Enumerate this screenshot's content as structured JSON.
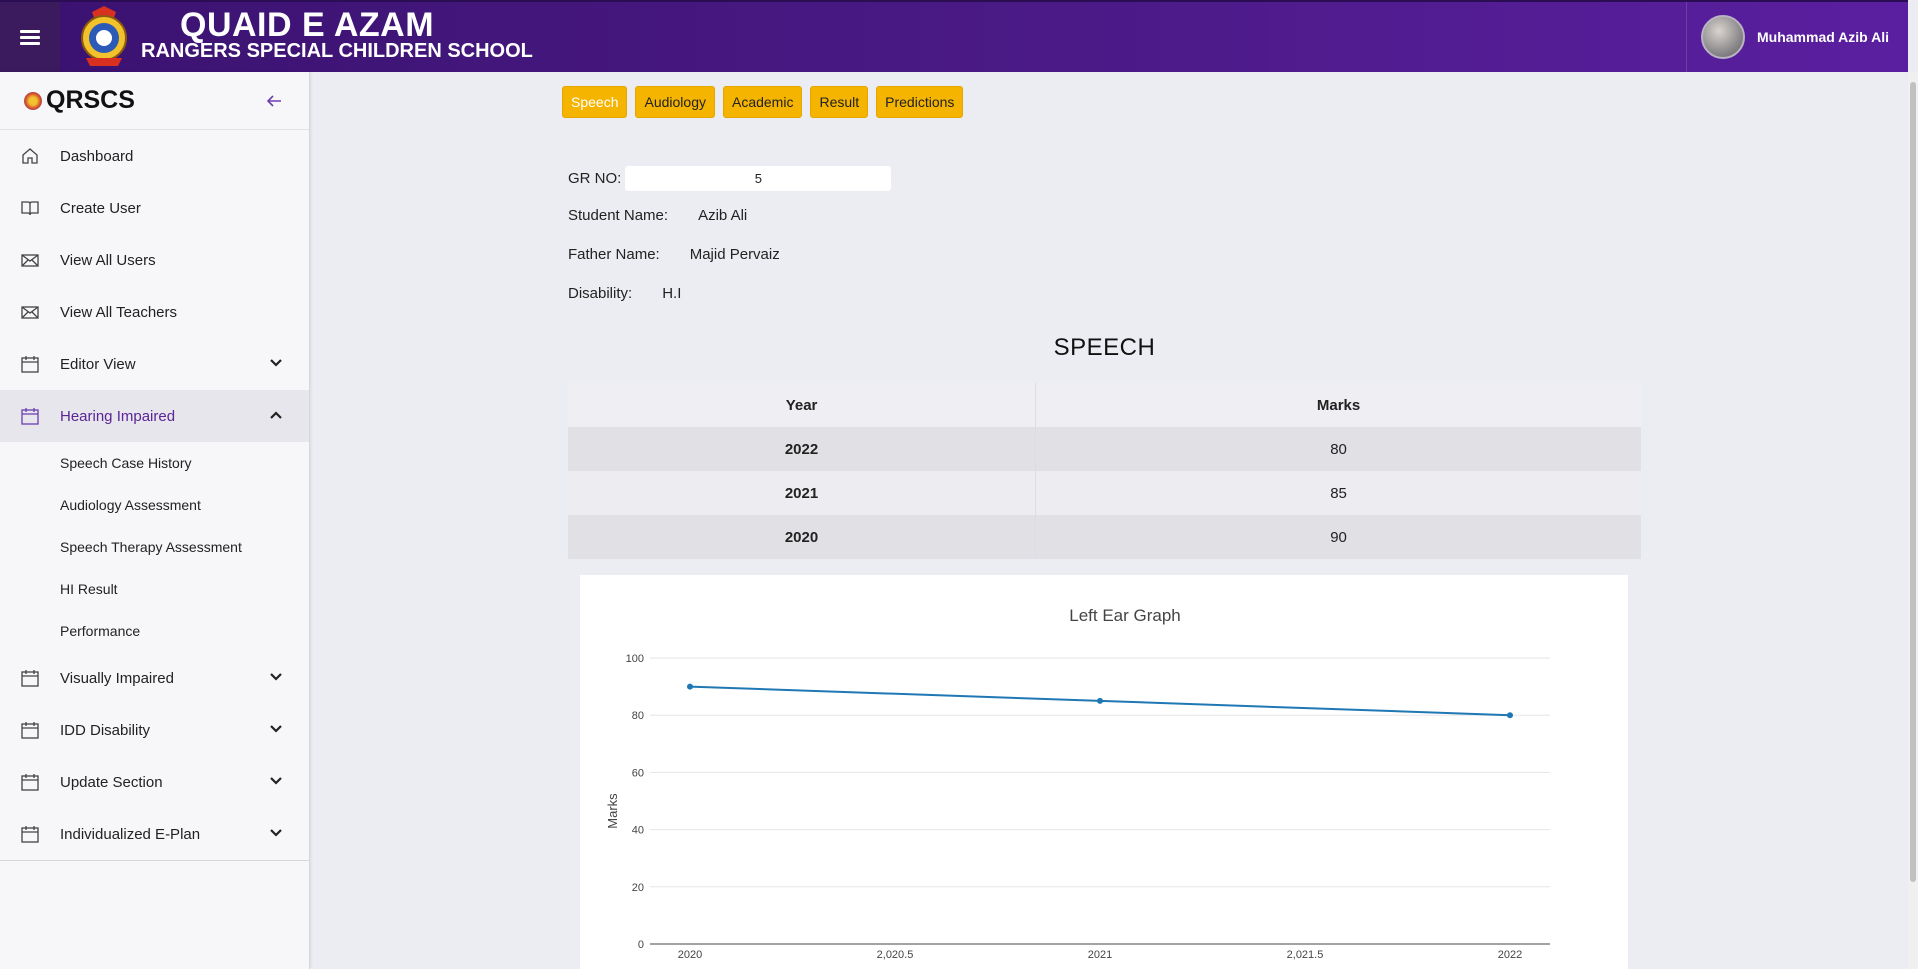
{
  "header": {
    "brand_line1": "QUAID E AZAM",
    "brand_line2": "RANGERS SPECIAL CHILDREN SCHOOL",
    "user_name": "Muhammad Azib Ali"
  },
  "sidebar": {
    "brand": "QRSCS",
    "items": [
      {
        "label": "Dashboard",
        "icon": "home-icon"
      },
      {
        "label": "Create User",
        "icon": "book-icon"
      },
      {
        "label": "View All Users",
        "icon": "mail-icon"
      },
      {
        "label": "View All Teachers",
        "icon": "mail-icon"
      },
      {
        "label": "Editor View",
        "icon": "calendar-icon",
        "expandable": true
      },
      {
        "label": "Hearing Impaired",
        "icon": "calendar-icon",
        "expandable": true,
        "active": true
      }
    ],
    "sub_items": [
      "Speech Case History",
      "Audiology Assessment",
      "Speech Therapy Assessment",
      "HI Result",
      "Performance"
    ],
    "items_after": [
      {
        "label": "Visually Impaired",
        "icon": "calendar-icon"
      },
      {
        "label": "IDD Disability",
        "icon": "calendar-icon"
      },
      {
        "label": "Update Section",
        "icon": "calendar-icon"
      },
      {
        "label": "Individualized E-Plan",
        "icon": "calendar-icon"
      }
    ]
  },
  "tabs": [
    "Speech",
    "Audiology",
    "Academic",
    "Result",
    "Predictions"
  ],
  "student": {
    "gr_label": "GR NO:",
    "gr_value": "5",
    "name_label": "Student Name:",
    "name_value": "Azib Ali",
    "father_label": "Father Name:",
    "father_value": "Majid Pervaiz",
    "disability_label": "Disability:",
    "disability_value": "H.I"
  },
  "section_title": "SPEECH",
  "table": {
    "headers": [
      "Year",
      "Marks"
    ],
    "rows": [
      [
        "2022",
        "80"
      ],
      [
        "2021",
        "85"
      ],
      [
        "2020",
        "90"
      ]
    ]
  },
  "chart_data": {
    "type": "line",
    "title": "Left Ear Graph",
    "xlabel": "",
    "ylabel": "Marks",
    "x": [
      2020,
      2021,
      2022
    ],
    "series": [
      {
        "values": [
          90,
          85,
          80
        ]
      }
    ],
    "xlim": [
      2020,
      2022
    ],
    "ylim": [
      0,
      100
    ],
    "x_tick_labels": [
      "2020",
      "2,020.5",
      "2021",
      "2,021.5",
      "2022"
    ],
    "x_ticks": [
      2020,
      2020.5,
      2021,
      2021.5,
      2022
    ],
    "y_ticks": [
      0,
      20,
      40,
      60,
      80,
      100
    ],
    "grid": true,
    "color": "#1f77b4"
  }
}
